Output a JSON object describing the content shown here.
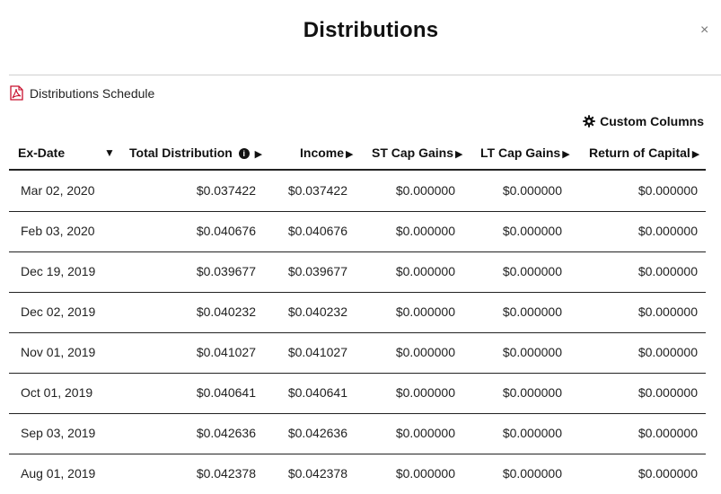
{
  "dialog": {
    "title": "Distributions",
    "close_label": "×"
  },
  "schedule_link": {
    "label": "Distributions Schedule",
    "icon": "pdf-icon",
    "icon_color": "#c8102e"
  },
  "custom_columns": {
    "label": "Custom Columns",
    "icon": "gear-icon"
  },
  "table": {
    "headers": {
      "ex_date": "Ex-Date",
      "ex_date_sort": "▼",
      "total": "Total Distribution",
      "total_info": "ℹ",
      "income": "Income",
      "st_cap_gains": "ST Cap Gains",
      "lt_cap_gains": "LT Cap Gains",
      "return_of_capital": "Return of Capital",
      "arrow": "▶"
    },
    "rows": [
      {
        "ex_date": "Mar 02, 2020",
        "total": "$0.037422",
        "income": "$0.037422",
        "st": "$0.000000",
        "lt": "$0.000000",
        "roc": "$0.000000"
      },
      {
        "ex_date": "Feb 03, 2020",
        "total": "$0.040676",
        "income": "$0.040676",
        "st": "$0.000000",
        "lt": "$0.000000",
        "roc": "$0.000000"
      },
      {
        "ex_date": "Dec 19, 2019",
        "total": "$0.039677",
        "income": "$0.039677",
        "st": "$0.000000",
        "lt": "$0.000000",
        "roc": "$0.000000"
      },
      {
        "ex_date": "Dec 02, 2019",
        "total": "$0.040232",
        "income": "$0.040232",
        "st": "$0.000000",
        "lt": "$0.000000",
        "roc": "$0.000000"
      },
      {
        "ex_date": "Nov 01, 2019",
        "total": "$0.041027",
        "income": "$0.041027",
        "st": "$0.000000",
        "lt": "$0.000000",
        "roc": "$0.000000"
      },
      {
        "ex_date": "Oct 01, 2019",
        "total": "$0.040641",
        "income": "$0.040641",
        "st": "$0.000000",
        "lt": "$0.000000",
        "roc": "$0.000000"
      },
      {
        "ex_date": "Sep 03, 2019",
        "total": "$0.042636",
        "income": "$0.042636",
        "st": "$0.000000",
        "lt": "$0.000000",
        "roc": "$0.000000"
      },
      {
        "ex_date": "Aug 01, 2019",
        "total": "$0.042378",
        "income": "$0.042378",
        "st": "$0.000000",
        "lt": "$0.000000",
        "roc": "$0.000000"
      }
    ]
  }
}
